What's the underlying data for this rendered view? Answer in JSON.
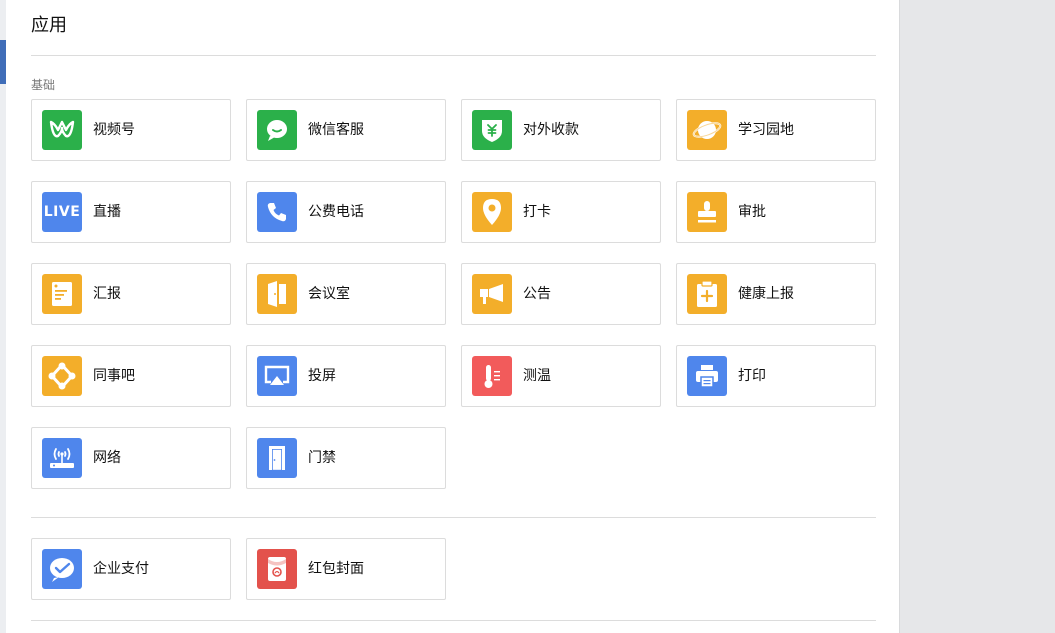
{
  "page": {
    "title": "应用"
  },
  "sections": {
    "basic": {
      "label": "基础"
    }
  },
  "apps": {
    "channels": {
      "label": "视频号",
      "icon": "channels-icon",
      "color": "#2bb04a"
    },
    "wecom_cs": {
      "label": "微信客服",
      "icon": "chat-bubble-icon",
      "color": "#2bb04a"
    },
    "collect": {
      "label": "对外收款",
      "icon": "yuan-shield-icon",
      "color": "#2bb04a"
    },
    "learning": {
      "label": "学习园地",
      "icon": "planet-icon",
      "color": "#f3ae2a"
    },
    "live": {
      "label": "直播",
      "icon": "live-icon",
      "color": "#4f86ec",
      "icon_text": "LIVE"
    },
    "phone": {
      "label": "公费电话",
      "icon": "phone-icon",
      "color": "#4f86ec"
    },
    "checkin": {
      "label": "打卡",
      "icon": "location-pin-icon",
      "color": "#f3ae2a"
    },
    "approval": {
      "label": "审批",
      "icon": "stamp-icon",
      "color": "#f3ae2a"
    },
    "report": {
      "label": "汇报",
      "icon": "document-icon",
      "color": "#f3ae2a"
    },
    "meeting": {
      "label": "会议室",
      "icon": "door-icon",
      "color": "#f3ae2a"
    },
    "notice": {
      "label": "公告",
      "icon": "megaphone-icon",
      "color": "#f3ae2a"
    },
    "health": {
      "label": "健康上报",
      "icon": "clipboard-plus-icon",
      "color": "#f3ae2a"
    },
    "colleague": {
      "label": "同事吧",
      "icon": "network-nodes-icon",
      "color": "#f3ae2a"
    },
    "cast": {
      "label": "投屏",
      "icon": "airplay-icon",
      "color": "#4f86ec"
    },
    "temp": {
      "label": "测温",
      "icon": "thermometer-icon",
      "color": "#f25b5b"
    },
    "print": {
      "label": "打印",
      "icon": "printer-icon",
      "color": "#4f86ec"
    },
    "network": {
      "label": "网络",
      "icon": "router-icon",
      "color": "#4f86ec"
    },
    "access": {
      "label": "门禁",
      "icon": "access-door-icon",
      "color": "#4f86ec"
    },
    "pay": {
      "label": "企业支付",
      "icon": "pay-check-icon",
      "color": "#4f86ec"
    },
    "redpacket": {
      "label": "红包封面",
      "icon": "red-packet-icon",
      "color": "#e3524c"
    }
  }
}
